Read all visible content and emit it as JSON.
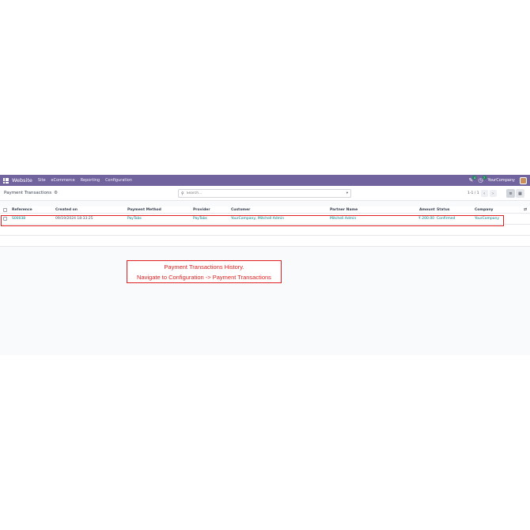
{
  "navbar": {
    "brand": "Website",
    "menu": [
      "Site",
      "eCommerce",
      "Reporting",
      "Configuration"
    ],
    "chat_badge": "4",
    "activity_badge": "7",
    "company": "YourCompany"
  },
  "control_panel": {
    "title": "Payment Transactions",
    "search_placeholder": "Search...",
    "pager": "1-1 / 1"
  },
  "table": {
    "columns": [
      "Reference",
      "Created on",
      "Payment Method",
      "Provider",
      "Customer",
      "Partner Name",
      "Amount",
      "Status",
      "Company"
    ],
    "rows": [
      {
        "reference": "S00038",
        "created_on": "09/19/2024 18:33:25",
        "payment_method": "PayTabs",
        "provider": "PayTabs",
        "customer": "YourCompany, Mitchell Admin",
        "partner_name": "Mitchell Admin",
        "amount": "₹ 200.00",
        "status": "Confirmed",
        "company": "YourCompany"
      }
    ]
  },
  "annotation": {
    "line1": "Payment Transactions History.",
    "line2": "Navigate to Configuration -> Payment Transactions"
  },
  "colors": {
    "navbar": "#71639e",
    "highlight": "#e02020",
    "link": "#017e84"
  },
  "icons": {
    "apps": "apps-grid-icon",
    "chat": "chat-icon",
    "activity": "clock-icon",
    "gear": "gear-icon",
    "search": "search-icon",
    "list_view": "list-view-icon",
    "kanban_view": "kanban-view-icon",
    "optional_columns": "sliders-icon"
  }
}
